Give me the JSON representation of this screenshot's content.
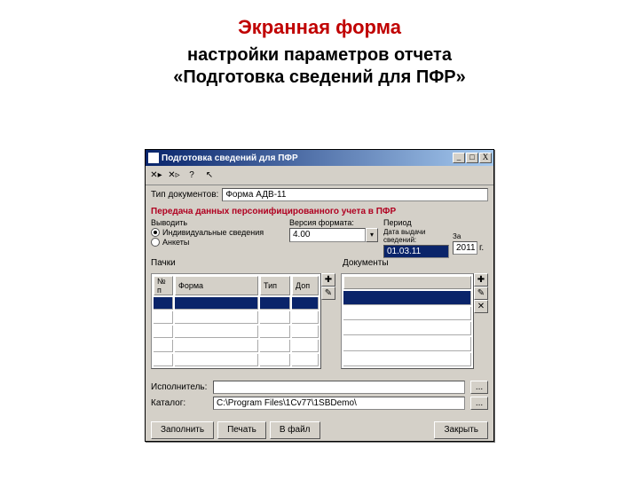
{
  "page": {
    "title": "Экранная форма",
    "subtitle1": "настройки параметров отчета",
    "subtitle2": "«Подготовка сведений для ПФР»"
  },
  "window": {
    "title": "Подготовка сведений для ПФР",
    "min": "_",
    "max": "□",
    "close": "X"
  },
  "toolbar": {
    "i1": "✕▸",
    "i2": "✕▹",
    "i3": "?",
    "i4": "↖"
  },
  "docTypeRow": {
    "label": "Тип документов:",
    "value": "Форма АДВ-11"
  },
  "section": {
    "heading": "Передача данных персонифицированного учета в ПФР"
  },
  "output": {
    "groupLabel": "Выводить",
    "opt1": "Индивидуальные сведения",
    "opt2": "Анкеты",
    "selected": 0
  },
  "format": {
    "label": "Версия формата:",
    "value": "4.00"
  },
  "period": {
    "groupLabel": "Период",
    "dateLabel": "Дата выдачи сведений:",
    "dateValue": "01.03.11",
    "zaLabel": "За",
    "yearValue": "2011",
    "yearSuffix": "г."
  },
  "tables": {
    "leftLabel": "Пачки",
    "rightLabel": "Документы",
    "leftCols": [
      "№ п",
      "Форма",
      "Тип",
      "Доп"
    ],
    "rightCols": [
      ""
    ],
    "addBtn1": "✚",
    "addBtn2": "✎",
    "addBtn3": "✚",
    "addBtn4": "✎",
    "addBtn5": "✕"
  },
  "bottom": {
    "performerLabel": "Исполнитель:",
    "performerValue": "",
    "dirLabel": "Каталог:",
    "dirValue": "C:\\Program Files\\1Cv77\\1SBDemo\\",
    "dots": "..."
  },
  "footer": {
    "fill": "Заполнить",
    "print": "Печать",
    "toFile": "В файл",
    "close": "Закрыть"
  }
}
